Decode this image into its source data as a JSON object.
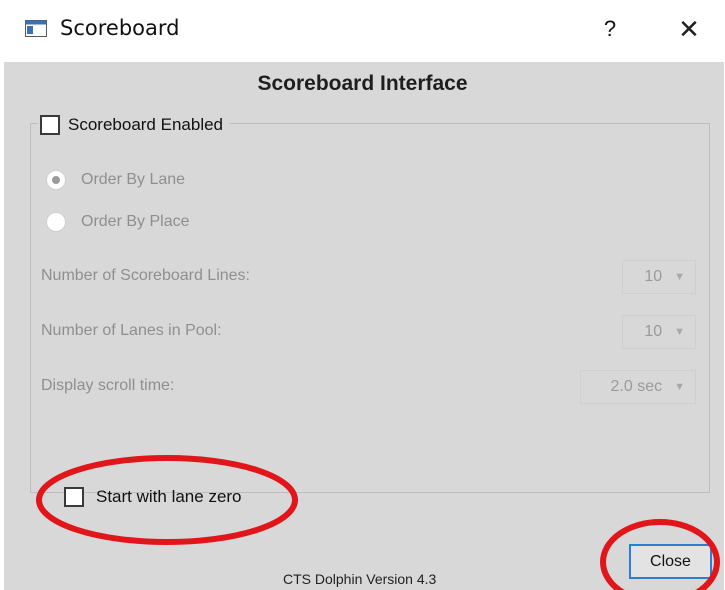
{
  "window": {
    "title": "Scoreboard",
    "help_glyph": "?",
    "close_glyph": "✕"
  },
  "header": {
    "title": "Scoreboard Interface"
  },
  "scoreboard_group": {
    "enabled_label": "Scoreboard Enabled",
    "enabled_checked": false,
    "order_options": [
      {
        "label": "Order By Lane",
        "selected": true
      },
      {
        "label": "Order By Place",
        "selected": false
      }
    ],
    "fields": [
      {
        "label": "Number of Scoreboard Lines:",
        "value": "10"
      },
      {
        "label": "Number of Lanes in Pool:",
        "value": "10"
      },
      {
        "label": "Display scroll time:",
        "value": "2.0 sec"
      }
    ]
  },
  "lane_zero": {
    "label": "Start with lane zero",
    "checked": false
  },
  "footer": {
    "version": "CTS Dolphin Version 4.3",
    "close_label": "Close"
  },
  "colors": {
    "background": "#d8d8d8",
    "annotation": "#e0161b",
    "focus_border": "#2a7fd4",
    "disabled_text": "#8f8f8f"
  },
  "icons": {
    "app": "window-app-icon",
    "dropdown": "chevron-down-icon"
  }
}
